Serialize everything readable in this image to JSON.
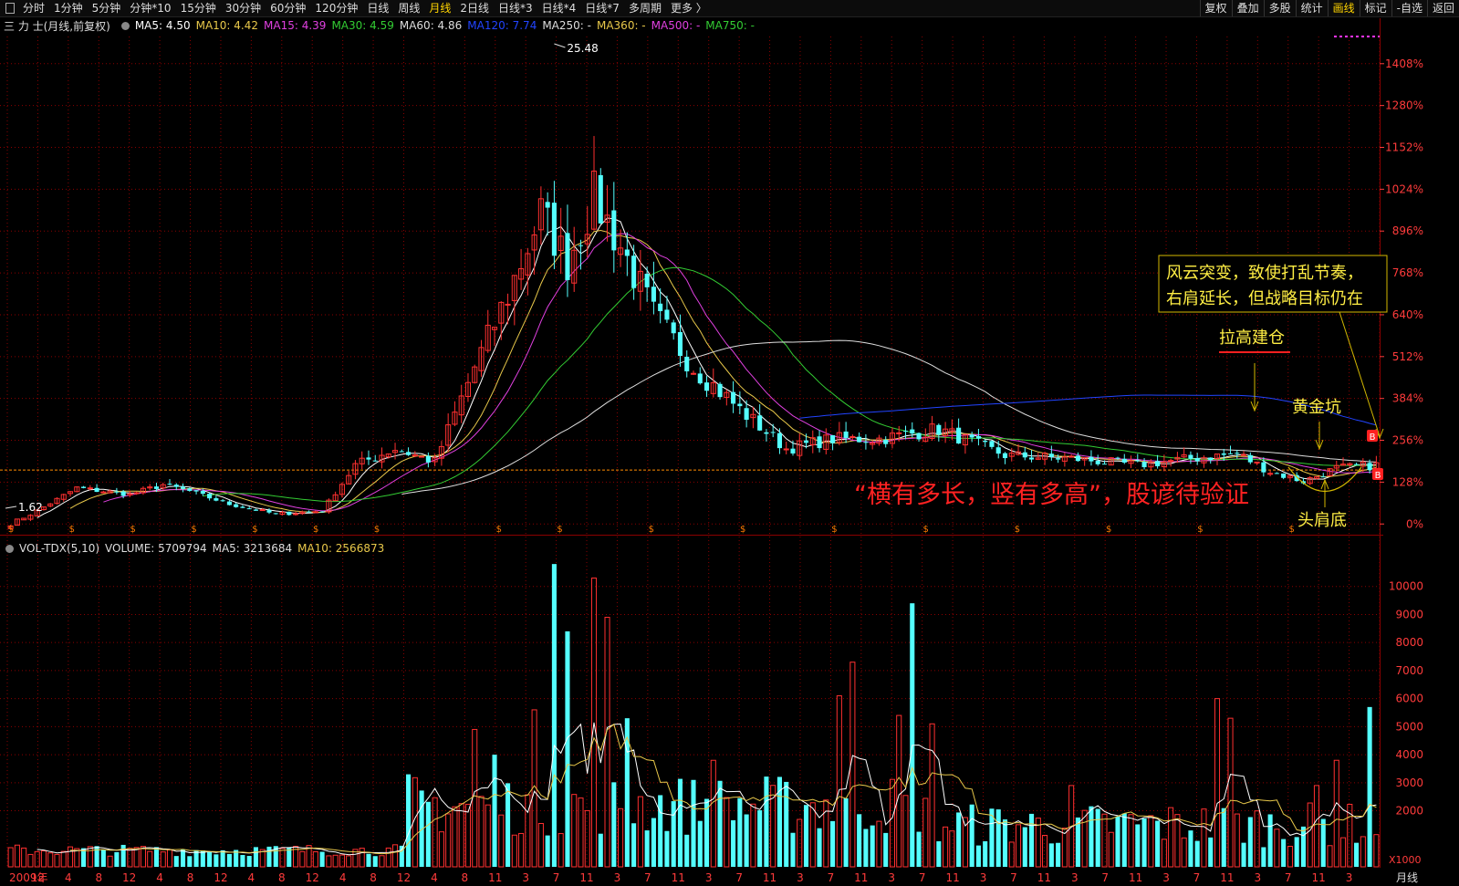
{
  "toolbar": {
    "periods": [
      "分时",
      "1分钟",
      "5分钟",
      "分钟*10",
      "15分钟",
      "30分钟",
      "60分钟",
      "120分钟",
      "日线",
      "周线",
      "月线",
      "2日线",
      "日线*3",
      "日线*4",
      "日线*7",
      "多周期",
      "更多 〉"
    ],
    "active_period": "月线",
    "right_items": [
      "复权",
      "叠加",
      "多股",
      "统计",
      "画线",
      "标记",
      "-自选",
      "返回"
    ],
    "right_active": "画线"
  },
  "header": {
    "stock": "三 力 士(月线,前复权)",
    "ma": [
      {
        "text": "MA5: 4.50",
        "color": "#ffffff"
      },
      {
        "text": "MA10: 4.42",
        "color": "#e8c84a"
      },
      {
        "text": "MA15: 4.39",
        "color": "#e040e0"
      },
      {
        "text": "MA30: 4.59",
        "color": "#33cc33"
      },
      {
        "text": "MA60: 4.86",
        "color": "#dddddd"
      },
      {
        "text": "MA120: 7.74",
        "color": "#2244ff"
      },
      {
        "text": "MA250: -",
        "color": "#dddddd"
      },
      {
        "text": "MA360: -",
        "color": "#e8c84a"
      },
      {
        "text": "MA500: -",
        "color": "#e040e0"
      },
      {
        "text": "MA750: -",
        "color": "#33cc33"
      }
    ]
  },
  "volume_header": {
    "title": "VOL-TDX(5,10)",
    "items": [
      {
        "text": "VOLUME: 5709794",
        "color": "#dddddd"
      },
      {
        "text": "MA5: 3213684",
        "color": "#dddddd"
      },
      {
        "text": "MA10: 2566873",
        "color": "#e8c84a"
      }
    ]
  },
  "annotations": {
    "box_line1": "风云突变，致使打乱节奏，",
    "box_line2": "右肩延长，但战略目标仍在",
    "build_position": "拉高建仓",
    "golden_pit": "黄金坑",
    "head_shoulders": "头肩底",
    "proverb": "“横有多长，竖有多高”，股谚待验证",
    "peak_label": "25.48",
    "low_label": "1.62",
    "buy_marker": "B",
    "dollar_marker": "$"
  },
  "colors": {
    "up": "#ff3030",
    "down": "#54ffff",
    "grid": "#8b0000",
    "axis_text": "#ff3b3b",
    "annotation_yellow": "#ffee44",
    "proverb_red": "#ff2222"
  },
  "chart_data": [
    {
      "type": "candlestick",
      "series_label": "三 力 士(月线,前复权)",
      "y_axis_ticks": [
        "1408%",
        "1280%",
        "1152%",
        "1024%",
        "896%",
        "768%",
        "640%",
        "512%",
        "384%",
        "256%",
        "128%",
        "0%"
      ],
      "y_tick_values": [
        1408,
        1280,
        1152,
        1024,
        896,
        768,
        640,
        512,
        384,
        256,
        128,
        0
      ],
      "reference_line_pct": 165,
      "x_axis_labels": [
        "2009年",
        "12",
        "4",
        "8",
        "12",
        "4",
        "8",
        "12",
        "4",
        "8",
        "12",
        "4",
        "8",
        "12",
        "4",
        "8",
        "11",
        "3",
        "7",
        "11",
        "3",
        "7",
        "11",
        "3",
        "7",
        "11",
        "3",
        "7",
        "11",
        "3",
        "7",
        "11",
        "3",
        "7",
        "11",
        "3",
        "7",
        "11",
        "3",
        "7",
        "11",
        "3",
        "7",
        "11",
        "3",
        "月线"
      ],
      "keypoints": [
        {
          "i": 0,
          "c": 0
        },
        {
          "i": 4,
          "c": 40
        },
        {
          "i": 10,
          "c": 110
        },
        {
          "i": 18,
          "c": 90
        },
        {
          "i": 23,
          "c": 120
        },
        {
          "i": 27,
          "c": 100
        },
        {
          "i": 33,
          "c": 60
        },
        {
          "i": 40,
          "c": 30
        },
        {
          "i": 47,
          "c": 40
        },
        {
          "i": 52,
          "c": 180
        },
        {
          "i": 58,
          "c": 230
        },
        {
          "i": 64,
          "c": 190
        },
        {
          "i": 70,
          "c": 480
        },
        {
          "i": 75,
          "c": 700
        },
        {
          "i": 80,
          "c": 950
        },
        {
          "i": 84,
          "c": 800
        },
        {
          "i": 88,
          "c": 1000
        },
        {
          "i": 92,
          "c": 850
        },
        {
          "i": 97,
          "c": 640
        },
        {
          "i": 103,
          "c": 480
        },
        {
          "i": 110,
          "c": 350
        },
        {
          "i": 117,
          "c": 230
        },
        {
          "i": 124,
          "c": 260
        },
        {
          "i": 131,
          "c": 260
        },
        {
          "i": 140,
          "c": 290
        },
        {
          "i": 150,
          "c": 210
        },
        {
          "i": 160,
          "c": 200
        },
        {
          "i": 170,
          "c": 180
        },
        {
          "i": 178,
          "c": 200
        },
        {
          "i": 185,
          "c": 215
        },
        {
          "i": 190,
          "c": 160
        },
        {
          "i": 195,
          "c": 130
        },
        {
          "i": 200,
          "c": 170
        },
        {
          "i": 206,
          "c": 180
        }
      ],
      "candle_count": 207
    },
    {
      "type": "bar",
      "series_label": "VOL-TDX(5,10)",
      "y_axis_ticks": [
        "10000",
        "9000",
        "8000",
        "7000",
        "6000",
        "5000",
        "4000",
        "3000",
        "2000"
      ],
      "y_tick_values": [
        10000,
        9000,
        8000,
        7000,
        6000,
        5000,
        4000,
        3000,
        2000
      ],
      "unit_label": "X1000",
      "spikes": [
        {
          "i": 60,
          "v": 3300
        },
        {
          "i": 70,
          "v": 4900
        },
        {
          "i": 73,
          "v": 4000
        },
        {
          "i": 79,
          "v": 5600
        },
        {
          "i": 82,
          "v": 10800
        },
        {
          "i": 84,
          "v": 8400
        },
        {
          "i": 88,
          "v": 10300
        },
        {
          "i": 90,
          "v": 8900
        },
        {
          "i": 93,
          "v": 5300
        },
        {
          "i": 106,
          "v": 3800
        },
        {
          "i": 125,
          "v": 6100
        },
        {
          "i": 127,
          "v": 7300
        },
        {
          "i": 134,
          "v": 5400
        },
        {
          "i": 136,
          "v": 9400
        },
        {
          "i": 139,
          "v": 5100
        },
        {
          "i": 160,
          "v": 2900
        },
        {
          "i": 182,
          "v": 6000
        },
        {
          "i": 184,
          "v": 5300
        },
        {
          "i": 197,
          "v": 2900
        },
        {
          "i": 200,
          "v": 3800
        },
        {
          "i": 205,
          "v": 5700
        }
      ]
    }
  ]
}
